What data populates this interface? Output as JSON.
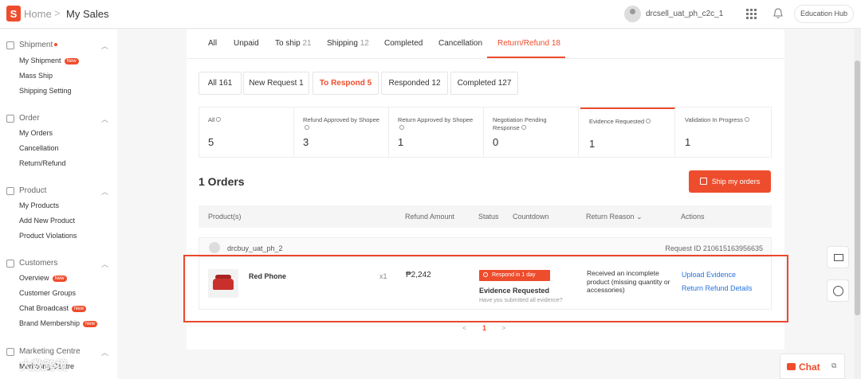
{
  "header": {
    "logo_letter": "S",
    "breadcrumb_home": "Home",
    "breadcrumb_sep": ">",
    "breadcrumb_current": "My Sales",
    "username": "drcsell_uat_ph_c2c_1",
    "education_hub": "Education Hub"
  },
  "sidebar": {
    "groups": [
      {
        "title": "Shipment",
        "items": [
          "My Shipment",
          "Mass Ship",
          "Shipping Setting"
        ]
      },
      {
        "title": "Order",
        "items": [
          "My Orders",
          "Cancellation",
          "Return/Refund"
        ]
      },
      {
        "title": "Product",
        "items": [
          "My Products",
          "Add New Product",
          "Product Violations"
        ]
      },
      {
        "title": "Customers",
        "items": [
          "Overview",
          "Customer Groups",
          "Chat Broadcast",
          "Brand Membership"
        ]
      },
      {
        "title": "Marketing Centre",
        "items": [
          "Marketing Centre"
        ]
      }
    ],
    "badge_new": "New"
  },
  "tabs": [
    {
      "label": "All",
      "count": ""
    },
    {
      "label": "Unpaid",
      "count": ""
    },
    {
      "label": "To ship",
      "count": "21"
    },
    {
      "label": "Shipping",
      "count": "12"
    },
    {
      "label": "Completed",
      "count": ""
    },
    {
      "label": "Cancellation",
      "count": ""
    },
    {
      "label": "Return/Refund",
      "count": "18"
    }
  ],
  "subtabs": [
    "All 161",
    "New Request 1",
    "To Respond 5",
    "Responded 12",
    "Completed 127"
  ],
  "stats": [
    {
      "label": "All",
      "value": "5"
    },
    {
      "label": "Refund Approved by Shopee",
      "value": "3"
    },
    {
      "label": "Return Approved by Shopee",
      "value": "1"
    },
    {
      "label": "Negotiation Pending Response",
      "value": "0"
    },
    {
      "label": "Evidence Requested",
      "value": "1"
    },
    {
      "label": "Validation In Progress",
      "value": "1"
    }
  ],
  "orders": {
    "title": "1 Orders",
    "ship_button": "Ship my orders",
    "columns": [
      "Product(s)",
      "Refund Amount",
      "Status",
      "Countdown",
      "Return Reason",
      "Actions"
    ],
    "buyer": "drcbuy_uat_ph_2",
    "request_id": "Request ID 210615163956635",
    "product_name": "Red Phone",
    "quantity": "x1",
    "amount": "₱2,242",
    "respond_badge": "Respond in 1 day",
    "status_title": "Evidence Requested",
    "status_sub": "Have you submitted all evidence?",
    "reason": "Received an incomplete product (missing quantity or accessories)",
    "action_upload": "Upload Evidence",
    "action_details": "Return Refund Details"
  },
  "pagination": {
    "prev": "<",
    "current": "1",
    "next": ">"
  },
  "chat": {
    "label": "Chat"
  },
  "watermark": "大数跨境",
  "colors": {
    "brand": "#ee4d2d",
    "link": "#2673dd",
    "highlight_box": "#e8492c"
  }
}
